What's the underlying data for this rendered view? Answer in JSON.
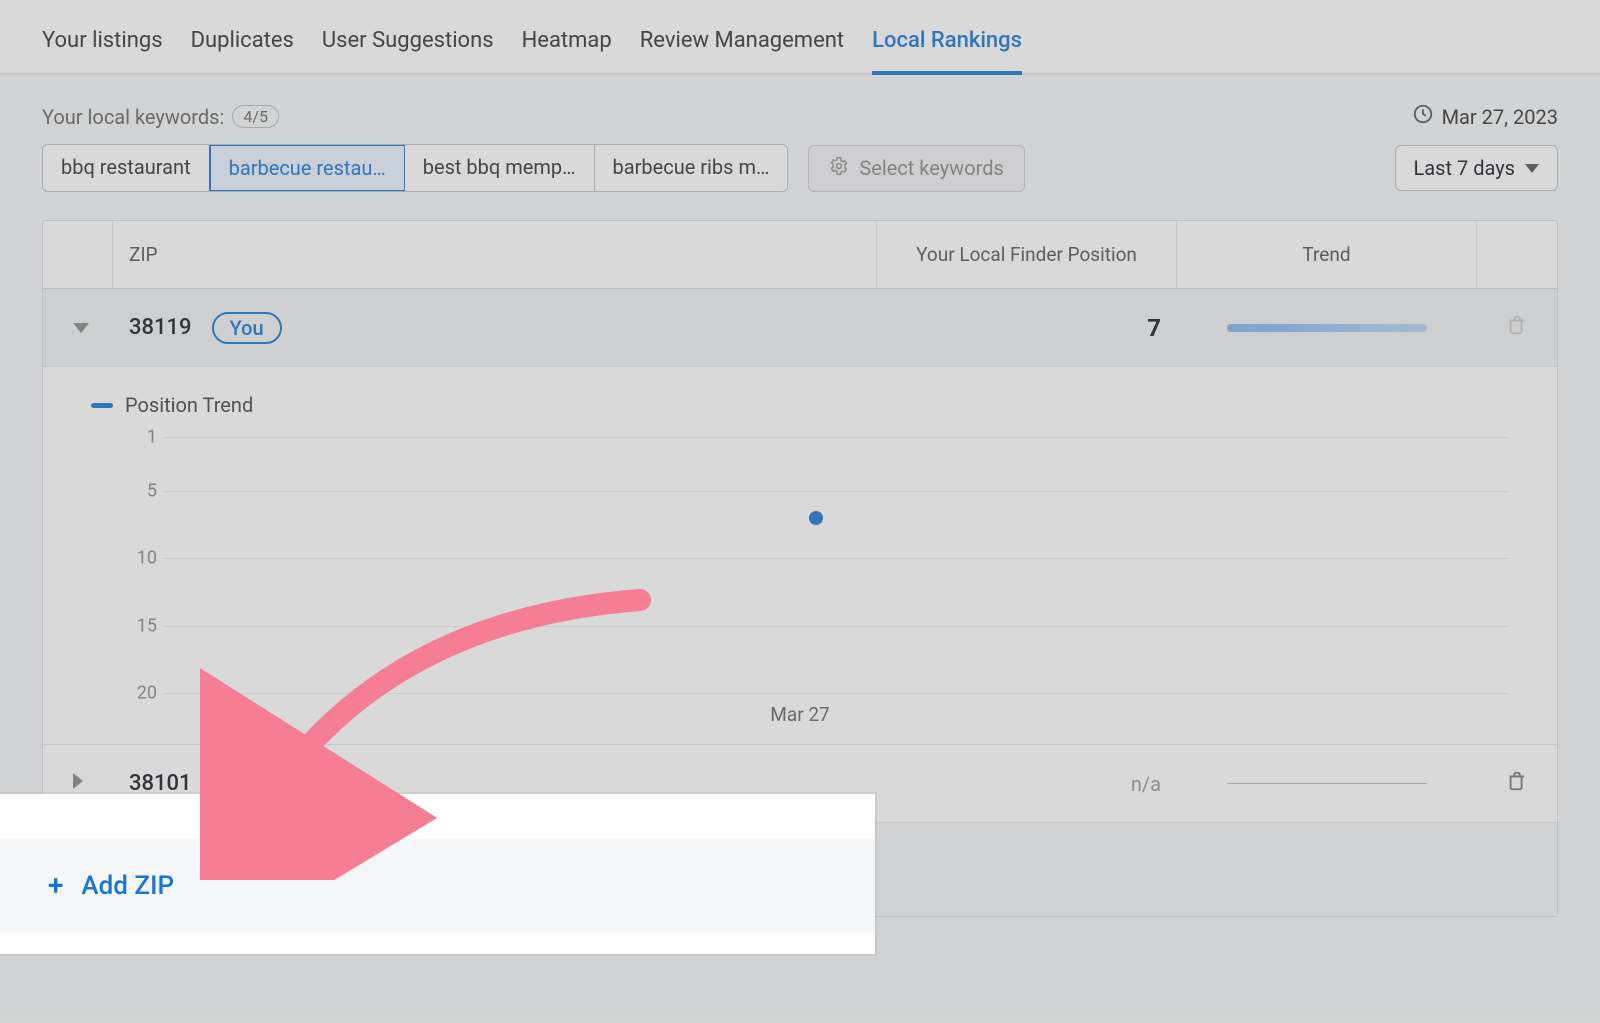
{
  "tabs": {
    "items": [
      {
        "label": "Your listings"
      },
      {
        "label": "Duplicates"
      },
      {
        "label": "User Suggestions"
      },
      {
        "label": "Heatmap"
      },
      {
        "label": "Review Management"
      },
      {
        "label": "Local Rankings"
      }
    ],
    "active_index": 5
  },
  "keywords": {
    "label": "Your local keywords:",
    "count": "4/5",
    "pills": [
      {
        "label": "bbq restaurant"
      },
      {
        "label": "barbecue restau…"
      },
      {
        "label": "best bbq memp…"
      },
      {
        "label": "barbecue ribs m…"
      }
    ],
    "selected_index": 1,
    "select_button": "Select keywords"
  },
  "date": "Mar 27, 2023",
  "range_label": "Last 7 days",
  "table": {
    "columns": {
      "zip": "ZIP",
      "position": "Your Local Finder Position",
      "trend": "Trend"
    },
    "rows": [
      {
        "zip": "38119",
        "you_badge": "You",
        "position": "7"
      },
      {
        "zip": "38101",
        "position": "n/a"
      }
    ]
  },
  "legend_label": "Position Trend",
  "chart_data": {
    "type": "scatter",
    "title": "Position Trend",
    "xlabel": "",
    "ylabel": "",
    "ylim": [
      20,
      1
    ],
    "y_ticks": [
      1,
      5,
      10,
      15,
      20
    ],
    "x_ticks": [
      "Mar 27"
    ],
    "series": [
      {
        "name": "Position Trend",
        "values": [
          {
            "x": "Mar 27",
            "y": 7
          }
        ]
      }
    ]
  },
  "add_zip_label": "Add ZIP"
}
